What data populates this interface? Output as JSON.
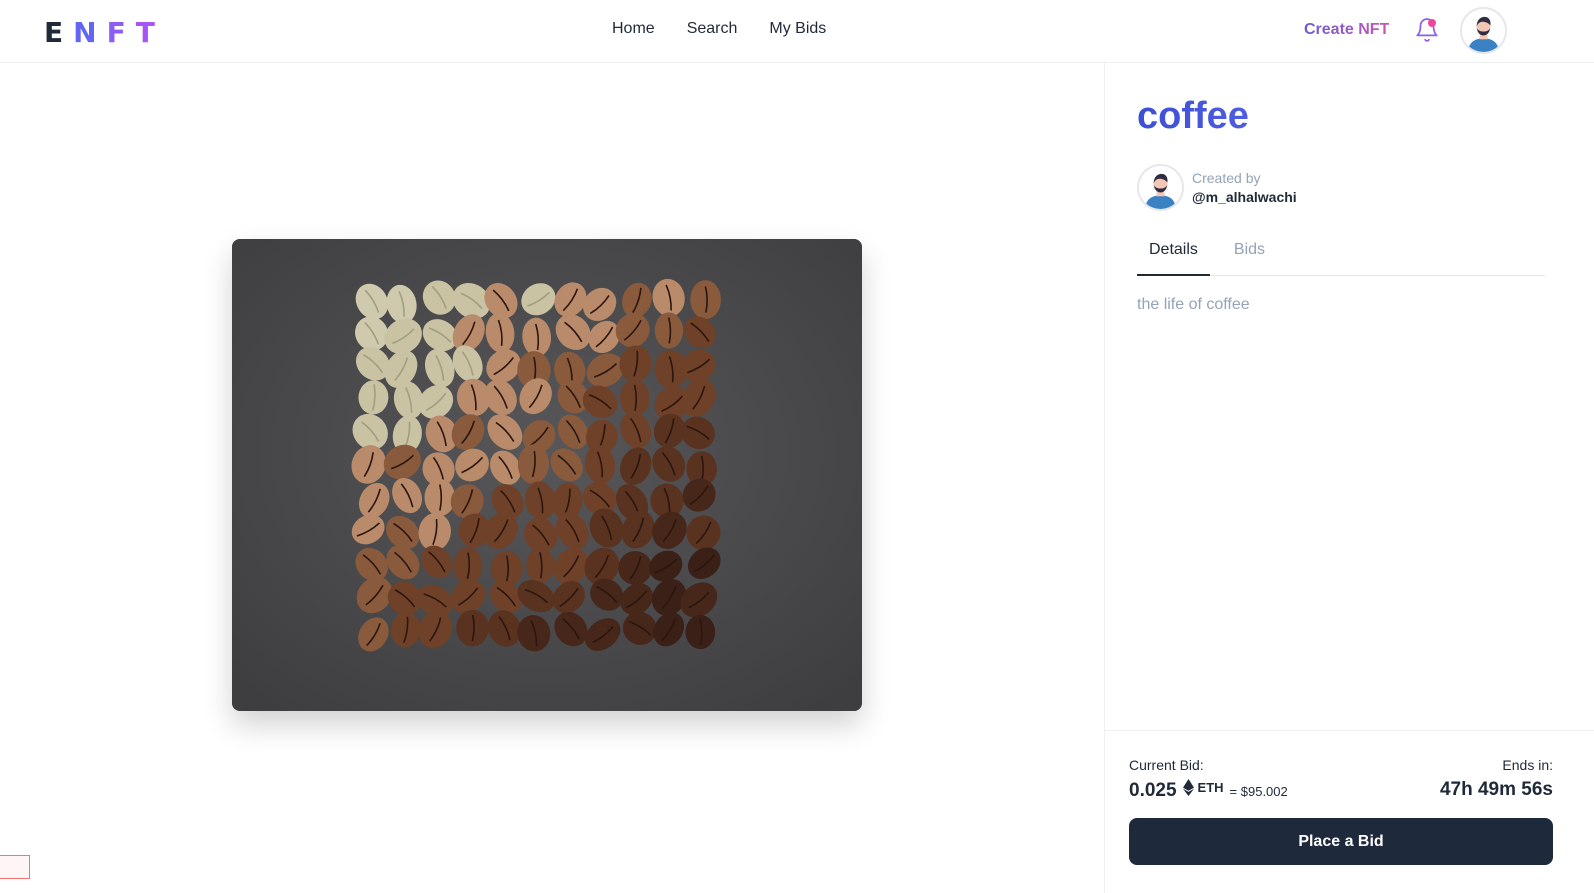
{
  "header": {
    "logo_letters": [
      "E",
      "N",
      "F",
      "T"
    ],
    "logo_colors": [
      "#1f2937",
      "#6366f1",
      "#8b5cf6",
      "#a855f7"
    ],
    "nav": [
      {
        "label": "Home"
      },
      {
        "label": "Search"
      },
      {
        "label": "My Bids"
      }
    ],
    "create_label": "Create NFT",
    "notification_icon": "bell-icon",
    "notification_dot_color": "#ec4899",
    "avatar_icon": "user-avatar-icon"
  },
  "nft": {
    "title": "coffee",
    "image_icon": "coffee-beans-image",
    "creator_label": "Created by",
    "creator_handle": "@m_alhalwachi",
    "tabs": [
      {
        "label": "Details",
        "active": true
      },
      {
        "label": "Bids",
        "active": false
      }
    ],
    "description": "the life of coffee"
  },
  "bid": {
    "current_label": "Current Bid:",
    "amount": "0.025",
    "currency": "ETH",
    "usd": "= $95.002",
    "ends_label": "Ends in:",
    "ends_value": "47h 49m 56s",
    "button_label": "Place a Bid"
  },
  "colors": {
    "accent": "#3b4fd6",
    "button": "#1e293b",
    "muted": "#94a3b8"
  }
}
